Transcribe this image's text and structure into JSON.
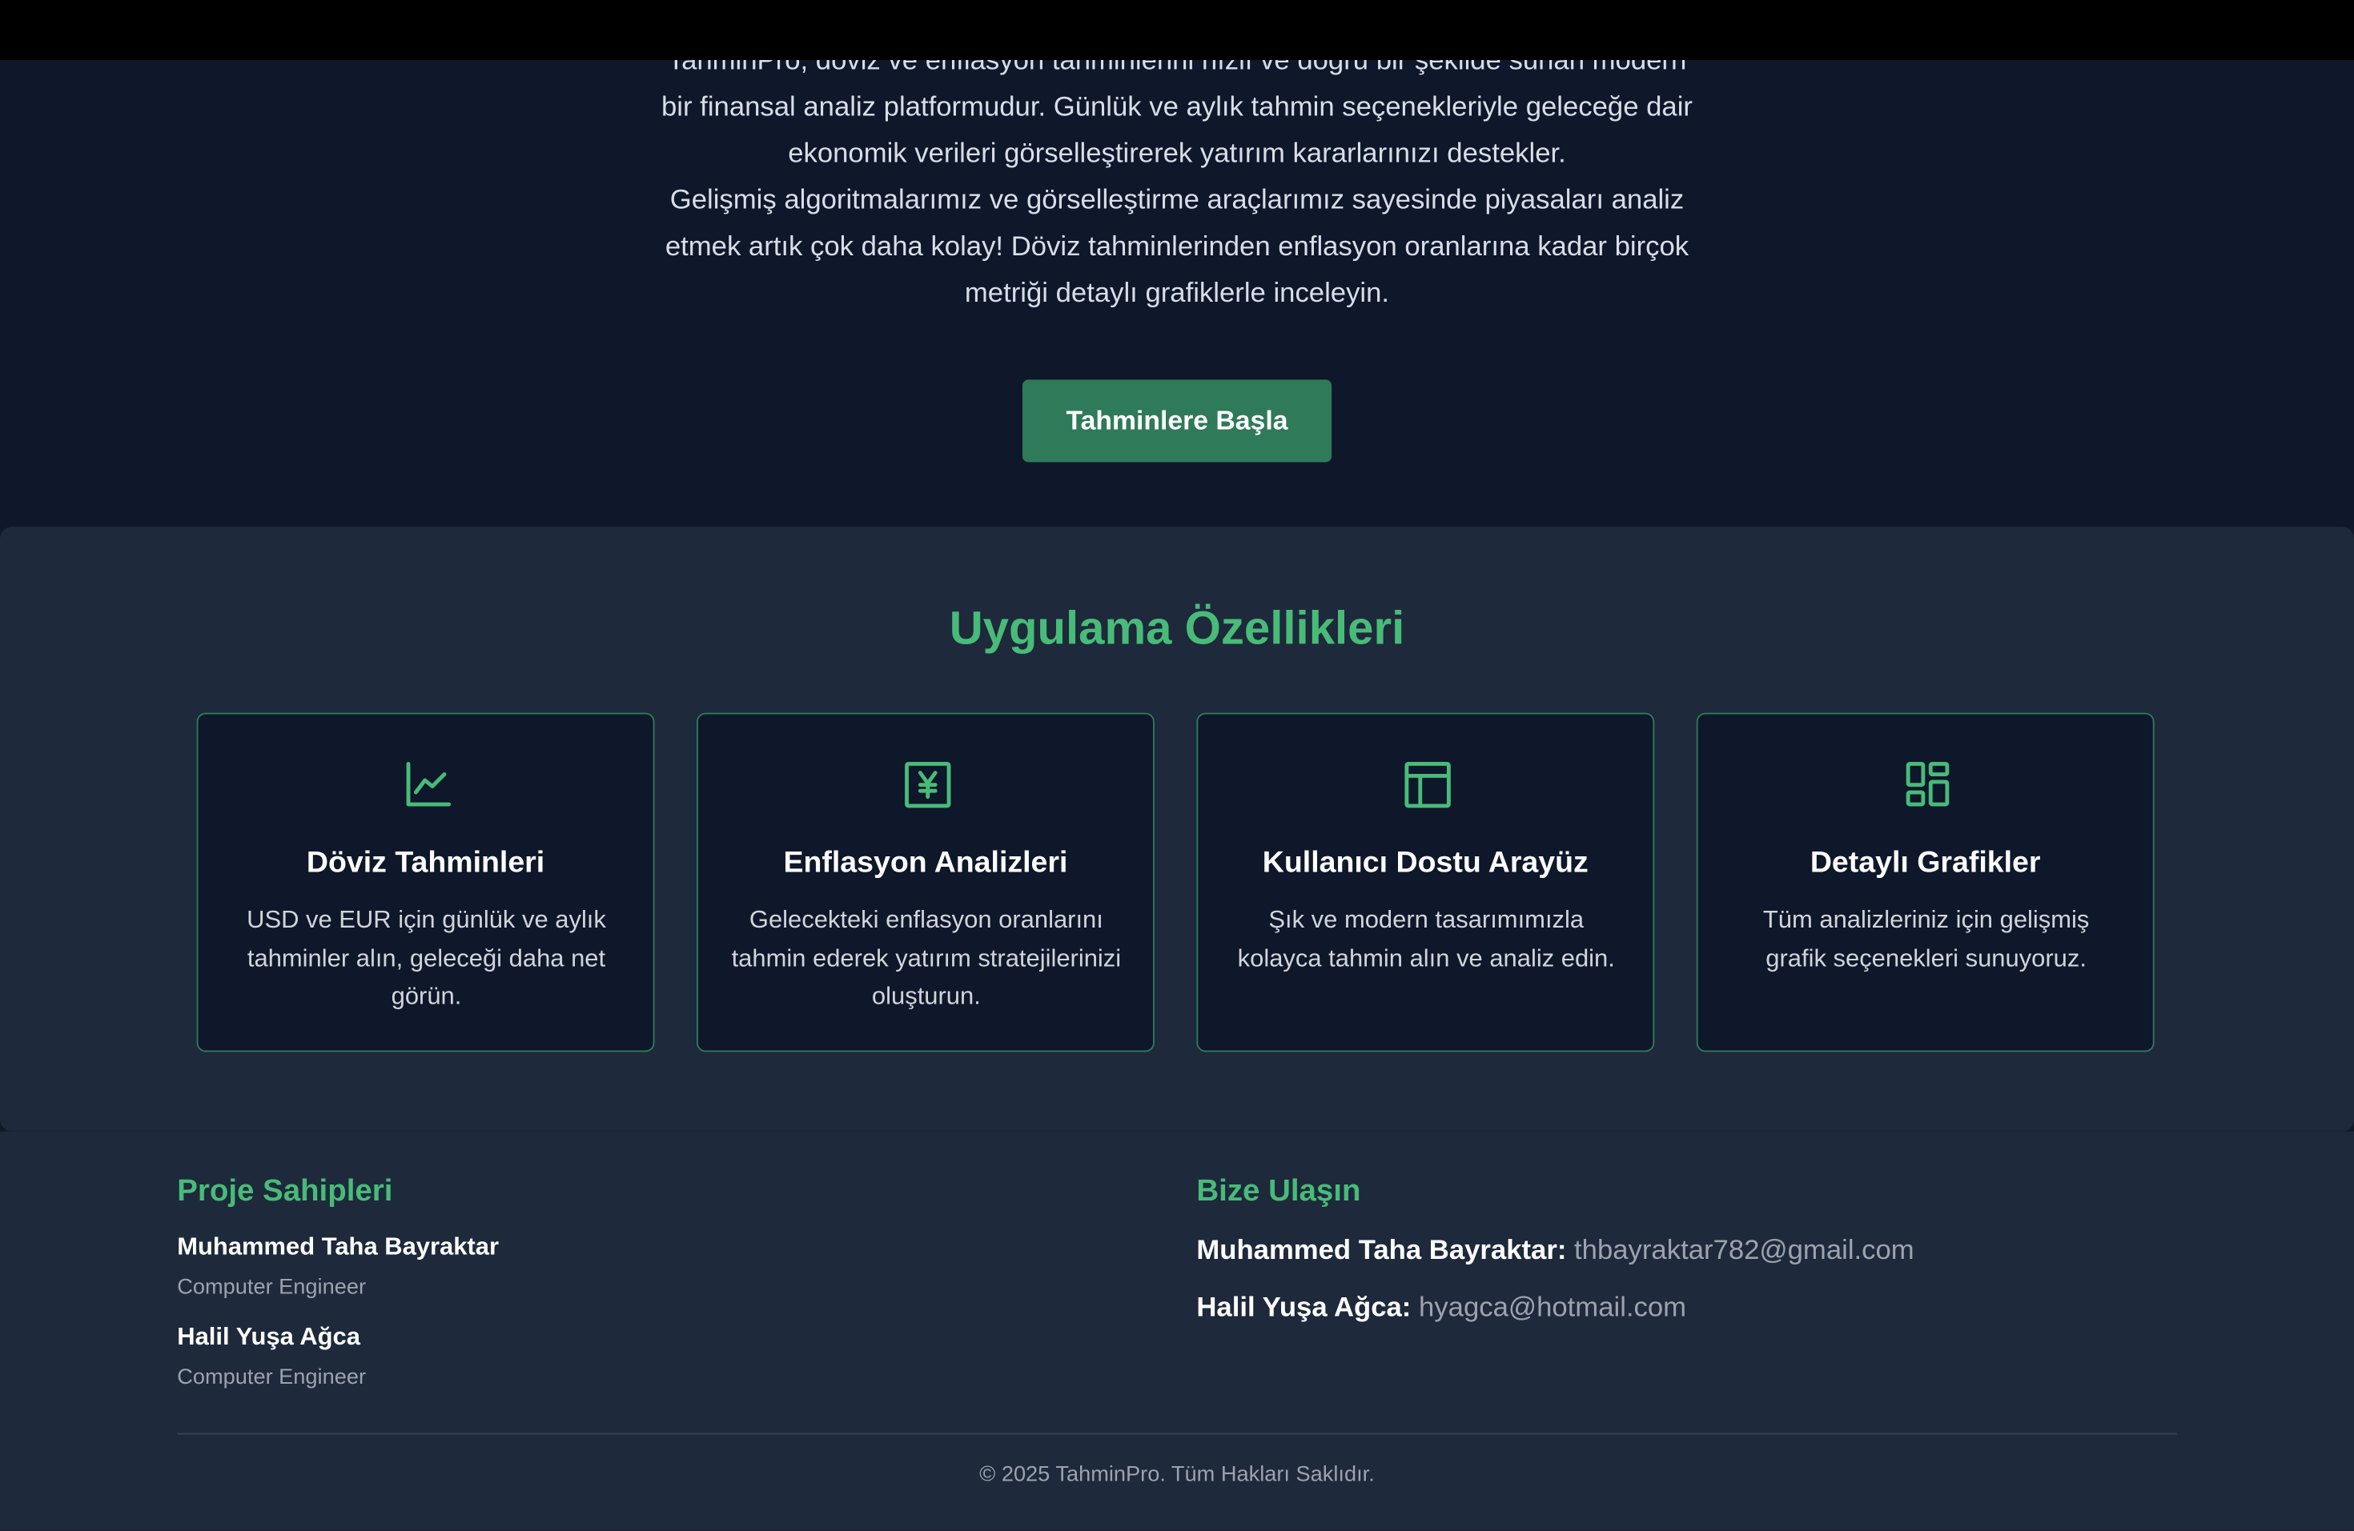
{
  "hero": {
    "paragraph_line_1": "TahminPro, döviz ve enflasyon tahminlerini hızlı ve doğru bir şekilde sunan modern",
    "paragraph_line_2": "bir finansal analiz platformudur. Günlük ve aylık tahmin seçenekleriyle geleceğe dair",
    "paragraph_line_3": "ekonomik verileri görselleştirerek yatırım kararlarınızı destekler.",
    "paragraph_line_4": "Gelişmiş algoritmalarımız ve görselleştirme araçlarımız sayesinde piyasaları analiz",
    "paragraph_line_5": "etmek artık çok daha kolay! Döviz tahminlerinden enflasyon oranlarına kadar birçok",
    "paragraph_line_6": "metriği detaylı grafiklerle inceleyin.",
    "cta_label": "Tahminlere Başla"
  },
  "features": {
    "title": "Uygulama Özellikleri",
    "cards": [
      {
        "icon": "chart-line-icon",
        "title": "Döviz Tahminleri",
        "description": "USD ve EUR için günlük ve aylık tahminler alın, geleceği daha net görün."
      },
      {
        "icon": "yen-icon",
        "title": "Enflasyon Analizleri",
        "description": "Gelecekteki enflasyon oranlarını tahmin ederek yatırım stratejilerinizi oluşturun."
      },
      {
        "icon": "layout-icon",
        "title": "Kullanıcı Dostu Arayüz",
        "description": "Şık ve modern tasarımımızla kolayca tahmin alın ve analiz edin."
      },
      {
        "icon": "dashboard-icon",
        "title": "Detaylı Grafikler",
        "description": "Tüm analizleriniz için gelişmiş grafik seçenekleri sunuyoruz."
      }
    ]
  },
  "footer": {
    "owners_heading": "Proje Sahipleri",
    "owners": [
      {
        "name": "Muhammed Taha Bayraktar",
        "role": "Computer Engineer"
      },
      {
        "name": "Halil Yuşa Ağca",
        "role": "Computer Engineer"
      }
    ],
    "contact_heading": "Bize Ulaşın",
    "contacts": [
      {
        "name": "Muhammed Taha Bayraktar:",
        "email": "thbayraktar782@gmail.com"
      },
      {
        "name": "Halil Yuşa Ağca:",
        "email": "hyagca@hotmail.com"
      }
    ],
    "copyright": "© 2025 TahminPro. Tüm Hakları Saklıdır."
  },
  "colors": {
    "accent": "#48bb78",
    "button": "#2f7a59",
    "hero_bg": "#0f172a",
    "section_bg": "#1e293b",
    "top_bar": "#000000"
  }
}
